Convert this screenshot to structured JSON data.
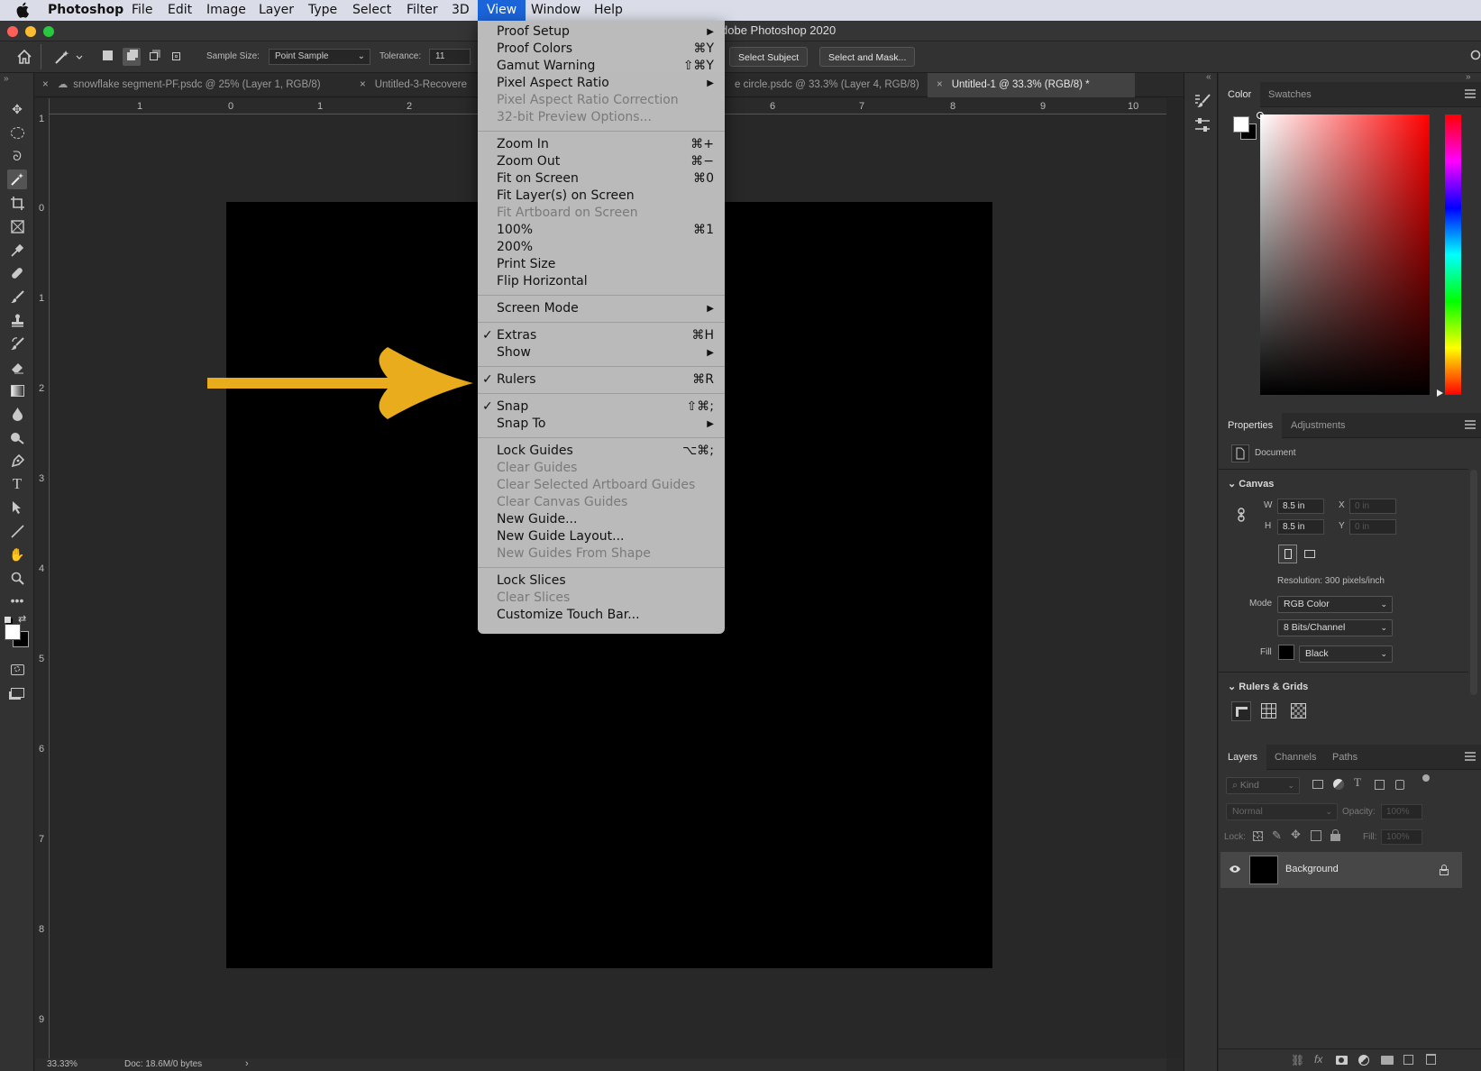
{
  "menubar": {
    "app": "Photoshop",
    "items": [
      "File",
      "Edit",
      "Image",
      "Layer",
      "Type",
      "Select",
      "Filter",
      "3D",
      "View",
      "Window",
      "Help"
    ]
  },
  "window": {
    "title": "dobe Photoshop 2020"
  },
  "options": {
    "sample_size_label": "Sample Size:",
    "sample_size_value": "Point Sample",
    "tolerance_label": "Tolerance:",
    "tolerance_value": "11",
    "select_subject": "Select Subject",
    "select_and_mask": "Select and Mask..."
  },
  "tabs": [
    {
      "label": "snowflake segment-PF.psdc @ 25% (Layer 1, RGB/8)"
    },
    {
      "label": "Untitled-3-Recovere"
    },
    {
      "label": "e circle.psdc @ 33.3% (Layer 4, RGB/8)"
    },
    {
      "label": "Untitled-1 @ 33.3% (RGB/8) *"
    }
  ],
  "ruler_h": [
    "1",
    "0",
    "1",
    "2",
    "6",
    "7",
    "8",
    "9",
    "10"
  ],
  "ruler_v": [
    "1",
    "0",
    "1",
    "2",
    "3",
    "4",
    "5",
    "6",
    "7",
    "8",
    "9"
  ],
  "status": {
    "zoom": "33.33%",
    "doc": "Doc: 18.6M/0 bytes"
  },
  "view_menu": {
    "items": [
      {
        "label": "Proof Setup",
        "shortcut": "",
        "submenu": true,
        "disabled": false,
        "checked": false
      },
      {
        "label": "Proof Colors",
        "shortcut": "⌘Y",
        "submenu": false,
        "disabled": false,
        "checked": false
      },
      {
        "label": "Gamut Warning",
        "shortcut": "⇧⌘Y",
        "submenu": false,
        "disabled": false,
        "checked": false
      },
      {
        "label": "Pixel Aspect Ratio",
        "shortcut": "",
        "submenu": true,
        "disabled": false,
        "checked": false
      },
      {
        "label": "Pixel Aspect Ratio Correction",
        "shortcut": "",
        "submenu": false,
        "disabled": true,
        "checked": false
      },
      {
        "label": "32-bit Preview Options...",
        "shortcut": "",
        "submenu": false,
        "disabled": true,
        "checked": false
      },
      {
        "separator": true
      },
      {
        "label": "Zoom In",
        "shortcut": "⌘+",
        "submenu": false,
        "disabled": false,
        "checked": false
      },
      {
        "label": "Zoom Out",
        "shortcut": "⌘−",
        "submenu": false,
        "disabled": false,
        "checked": false
      },
      {
        "label": "Fit on Screen",
        "shortcut": "⌘0",
        "submenu": false,
        "disabled": false,
        "checked": false
      },
      {
        "label": "Fit Layer(s) on Screen",
        "shortcut": "",
        "submenu": false,
        "disabled": false,
        "checked": false
      },
      {
        "label": "Fit Artboard on Screen",
        "shortcut": "",
        "submenu": false,
        "disabled": true,
        "checked": false
      },
      {
        "label": "100%",
        "shortcut": "⌘1",
        "submenu": false,
        "disabled": false,
        "checked": false
      },
      {
        "label": "200%",
        "shortcut": "",
        "submenu": false,
        "disabled": false,
        "checked": false
      },
      {
        "label": "Print Size",
        "shortcut": "",
        "submenu": false,
        "disabled": false,
        "checked": false
      },
      {
        "label": "Flip Horizontal",
        "shortcut": "",
        "submenu": false,
        "disabled": false,
        "checked": false
      },
      {
        "separator": true
      },
      {
        "label": "Screen Mode",
        "shortcut": "",
        "submenu": true,
        "disabled": false,
        "checked": false
      },
      {
        "separator": true
      },
      {
        "label": "Extras",
        "shortcut": "⌘H",
        "submenu": false,
        "disabled": false,
        "checked": true
      },
      {
        "label": "Show",
        "shortcut": "",
        "submenu": true,
        "disabled": false,
        "checked": false
      },
      {
        "separator": true
      },
      {
        "label": "Rulers",
        "shortcut": "⌘R",
        "submenu": false,
        "disabled": false,
        "checked": true
      },
      {
        "separator": true
      },
      {
        "label": "Snap",
        "shortcut": "⇧⌘;",
        "submenu": false,
        "disabled": false,
        "checked": true
      },
      {
        "label": "Snap To",
        "shortcut": "",
        "submenu": true,
        "disabled": false,
        "checked": false
      },
      {
        "separator": true
      },
      {
        "label": "Lock Guides",
        "shortcut": "⌥⌘;",
        "submenu": false,
        "disabled": false,
        "checked": false
      },
      {
        "label": "Clear Guides",
        "shortcut": "",
        "submenu": false,
        "disabled": true,
        "checked": false
      },
      {
        "label": "Clear Selected Artboard Guides",
        "shortcut": "",
        "submenu": false,
        "disabled": true,
        "checked": false
      },
      {
        "label": "Clear Canvas Guides",
        "shortcut": "",
        "submenu": false,
        "disabled": true,
        "checked": false
      },
      {
        "label": "New Guide...",
        "shortcut": "",
        "submenu": false,
        "disabled": false,
        "checked": false
      },
      {
        "label": "New Guide Layout...",
        "shortcut": "",
        "submenu": false,
        "disabled": false,
        "checked": false
      },
      {
        "label": "New Guides From Shape",
        "shortcut": "",
        "submenu": false,
        "disabled": true,
        "checked": false
      },
      {
        "separator": true
      },
      {
        "label": "Lock Slices",
        "shortcut": "",
        "submenu": false,
        "disabled": false,
        "checked": false
      },
      {
        "label": "Clear Slices",
        "shortcut": "",
        "submenu": false,
        "disabled": true,
        "checked": false
      },
      {
        "label": "Customize Touch Bar...",
        "shortcut": "",
        "submenu": false,
        "disabled": false,
        "checked": false
      }
    ]
  },
  "color_panel": {
    "tabs": [
      "Color",
      "Swatches"
    ]
  },
  "properties": {
    "tabs": [
      "Properties",
      "Adjustments"
    ],
    "doc_label": "Document",
    "canvas": "Canvas",
    "w_label": "W",
    "w_value": "8.5 in",
    "h_label": "H",
    "h_value": "8.5 in",
    "x_label": "X",
    "x_value": "0 in",
    "y_label": "Y",
    "y_value": "0 in",
    "resolution": "Resolution: 300 pixels/inch",
    "mode_label": "Mode",
    "mode_value": "RGB Color",
    "bits_value": "8 Bits/Channel",
    "fill_label": "Fill",
    "fill_value": "Black",
    "rulers_grids": "Rulers & Grids"
  },
  "layers": {
    "tabs": [
      "Layers",
      "Channels",
      "Paths"
    ],
    "kind": "Kind",
    "blend": "Normal",
    "opacity_label": "Opacity:",
    "opacity_value": "100%",
    "lock_label": "Lock:",
    "fill_label": "Fill:",
    "fill_value": "100%",
    "rows": [
      {
        "name": "Background"
      }
    ]
  },
  "colors": {
    "accent": "#1b64d9",
    "arrow": "#e9ac1c"
  }
}
